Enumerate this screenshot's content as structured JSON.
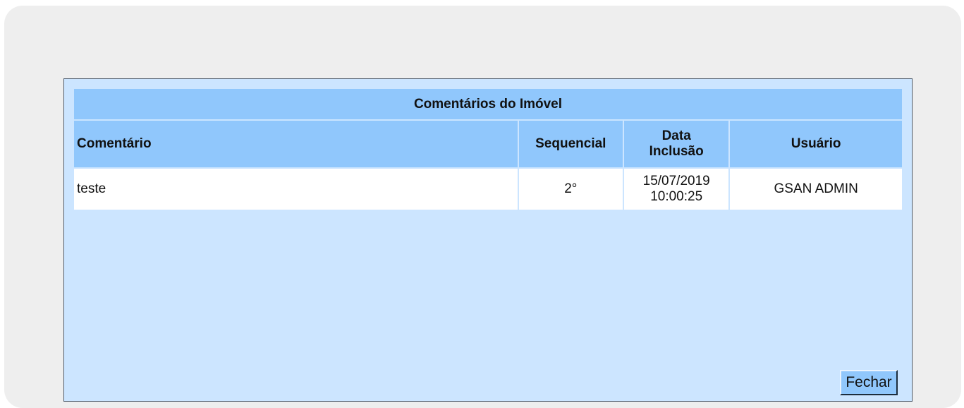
{
  "table": {
    "title": "Comentários do Imóvel",
    "headers": {
      "comentario": "Comentário",
      "sequencial": "Sequencial",
      "data_line1": "Data",
      "data_line2": "Inclusão",
      "usuario": "Usuário"
    },
    "rows": [
      {
        "comentario": "teste",
        "sequencial": "2°",
        "data_date": "15/07/2019",
        "data_time": "10:00:25",
        "usuario": "GSAN ADMIN"
      }
    ]
  },
  "actions": {
    "close_label": "Fechar"
  },
  "colors": {
    "panel_background": "#cce5ff",
    "header_background": "#90c7fc",
    "row_background": "#ffffff",
    "outer_background": "#eeeeee"
  }
}
